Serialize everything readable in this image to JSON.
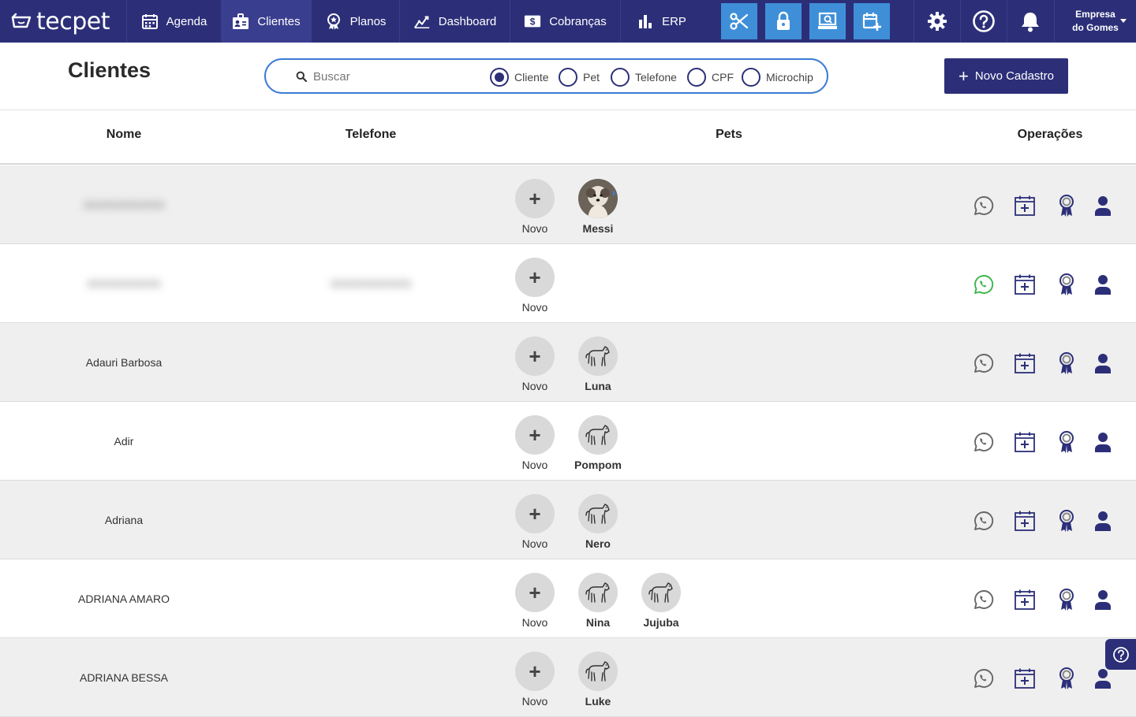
{
  "brand": {
    "name": "tecpet"
  },
  "nav": [
    {
      "label": "Agenda",
      "icon": "calendar-icon"
    },
    {
      "label": "Clientes",
      "icon": "client-card-icon",
      "active": true
    },
    {
      "label": "Planos",
      "icon": "medal-icon"
    },
    {
      "label": "Dashboard",
      "icon": "chart-line-icon"
    },
    {
      "label": "Cobranças",
      "icon": "dollar-bill-icon"
    },
    {
      "label": "ERP",
      "icon": "bar-chart-icon"
    }
  ],
  "quick_actions": [
    "scissors-icon",
    "lock-icon",
    "cash-register-icon",
    "calendar-plus-icon"
  ],
  "right_actions": [
    "gear-icon",
    "help-icon",
    "bell-icon"
  ],
  "company": {
    "line1": "Empresa",
    "line2": "do Gomes"
  },
  "page": {
    "title": "Clientes"
  },
  "search": {
    "placeholder": "Buscar",
    "value": "",
    "options": [
      {
        "label": "Cliente",
        "selected": true
      },
      {
        "label": "Pet",
        "selected": false
      },
      {
        "label": "Telefone",
        "selected": false
      },
      {
        "label": "CPF",
        "selected": false
      },
      {
        "label": "Microchip",
        "selected": false
      }
    ]
  },
  "new_button": {
    "label": "Novo Cadastro"
  },
  "table": {
    "headers": {
      "name": "Nome",
      "phone": "Telefone",
      "pets": "Pets",
      "ops": "Operações"
    },
    "add_pet_label": "Novo",
    "rows": [
      {
        "name": "XXXXXXXXXXX",
        "phone": "",
        "blur_name": true,
        "blur_phone": false,
        "whatsapp_active": false,
        "pets": [
          {
            "name": "Messi",
            "photo": true
          }
        ]
      },
      {
        "name": "XXXXXXXXXX",
        "phone": "XXXXXXXXXXX",
        "blur_name": true,
        "blur_phone": true,
        "whatsapp_active": true,
        "pets": []
      },
      {
        "name": "Adauri Barbosa",
        "phone": "",
        "whatsapp_active": false,
        "pets": [
          {
            "name": "Luna"
          }
        ]
      },
      {
        "name": "Adir",
        "phone": "",
        "whatsapp_active": false,
        "pets": [
          {
            "name": "Pompom"
          }
        ]
      },
      {
        "name": "Adriana",
        "phone": "",
        "whatsapp_active": false,
        "pets": [
          {
            "name": "Nero"
          }
        ]
      },
      {
        "name": "ADRIANA AMARO",
        "phone": "",
        "whatsapp_active": false,
        "pets": [
          {
            "name": "Nina"
          },
          {
            "name": "Jujuba"
          }
        ]
      },
      {
        "name": "ADRIANA BESSA",
        "phone": "",
        "whatsapp_active": false,
        "pets": [
          {
            "name": "Luke"
          }
        ]
      }
    ]
  },
  "colors": {
    "primary": "#2c2f78",
    "accent": "#3f8fd8",
    "whatsapp_active": "#3bb54a",
    "icon_gray": "#7a7a7a"
  }
}
